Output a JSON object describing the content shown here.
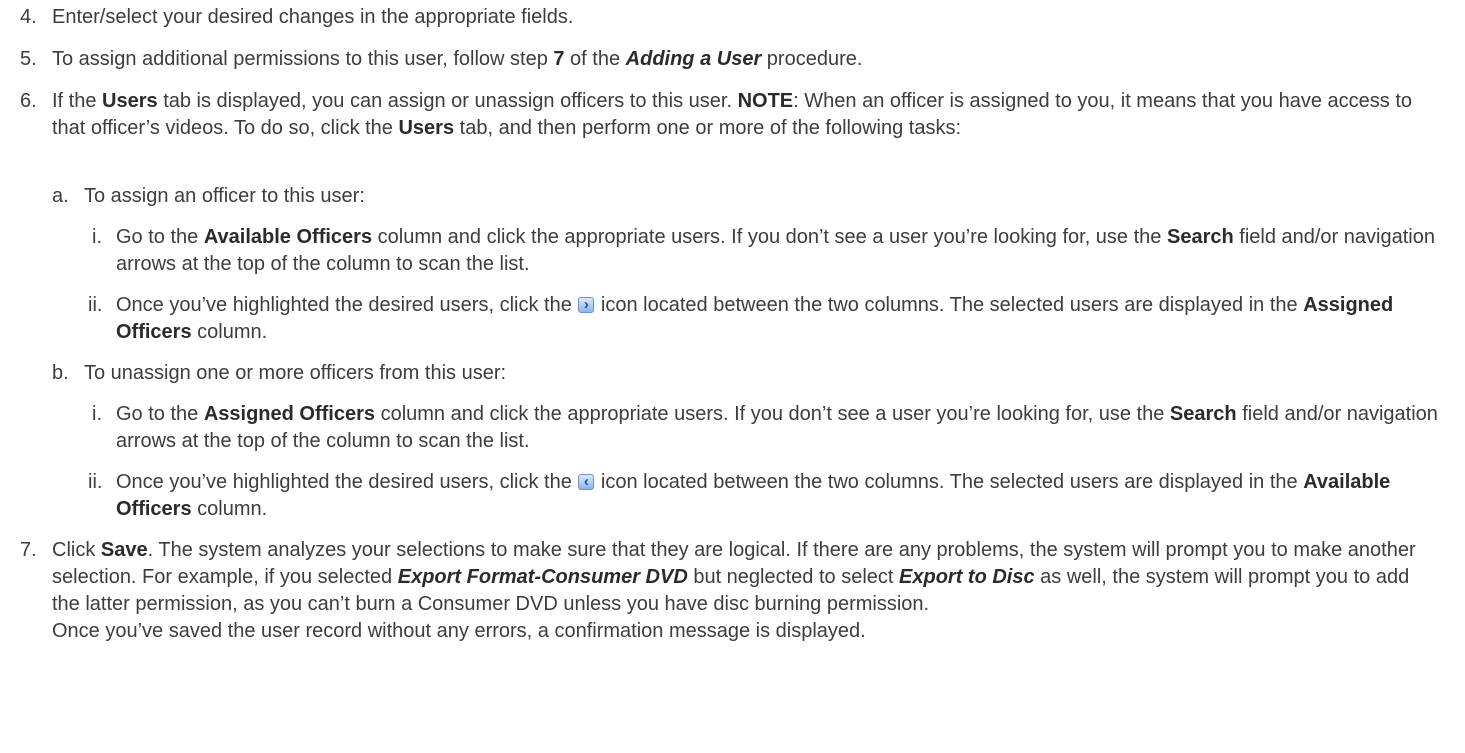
{
  "step4": {
    "num": "4.",
    "text": "Enter/select your desired changes in the appropriate fields."
  },
  "step5": {
    "num": "5.",
    "t1": "To assign additional permissions to this user, follow step ",
    "b1": "7",
    "t2": " of the ",
    "bi1": "Adding a User",
    "t3": " procedure."
  },
  "step6": {
    "num": "6.",
    "t1": "If the ",
    "b1": "Users",
    "t2": " tab is displayed, you can assign or unassign officers to this user. ",
    "b2": "NOTE",
    "t3": ": When an officer is assigned to you, it means that you have access to that officer’s videos. To do so, click the ",
    "b3": "Users",
    "t4": " tab, and then perform one or more of the following tasks:"
  },
  "step6a": {
    "num": "a.",
    "text": "To assign an officer to this user:",
    "i": {
      "num": "i.",
      "t1": "Go to the ",
      "b1": "Available Officers",
      "t2": " column and click the appropriate users. If you don’t see a user you’re looking for, use the ",
      "b2": "Search",
      "t3": " field and/or navigation arrows at the top of the column to scan the list."
    },
    "ii": {
      "num": "ii.",
      "t1": "Once you’ve highlighted the desired users, click the ",
      "t2": " icon located between the two columns. The selected users are displayed in the ",
      "b1": "Assigned Officers",
      "t3": " column."
    }
  },
  "step6b": {
    "num": "b.",
    "text": "To unassign one or more officers from this user:",
    "i": {
      "num": "i.",
      "t1": "Go to the ",
      "b1": "Assigned Officers",
      "t2": " column and click the appropriate users. If you don’t see a user you’re looking for, use the ",
      "b2": "Search",
      "t3": " field and/or navigation arrows at the top of the column to scan the list."
    },
    "ii": {
      "num": "ii.",
      "t1": "Once you’ve highlighted the desired users, click the ",
      "t2": " icon located between the two columns. The selected users are displayed in the ",
      "b1": "Available Officers",
      "t3": " column."
    }
  },
  "step7": {
    "num": "7.",
    "t1": "Click ",
    "b1": "Save",
    "t2": ". The system analyzes your selections to make sure that they are logical. If there are any problems, the system will prompt you to make another selection. For example, if you selected ",
    "bi1": "Export Format-Consumer DVD",
    "t3": " but neglected to select ",
    "bi2": "Export to Disc",
    "t4": " as well, the system will prompt you to add the latter permission, as you can’t burn a Consumer DVD unless you have disc burning permission.",
    "followup": "Once you’ve saved the user record without any errors, a confirmation message is displayed."
  },
  "icons": {
    "move_right": "chevron-right-icon",
    "move_left": "chevron-left-icon"
  }
}
